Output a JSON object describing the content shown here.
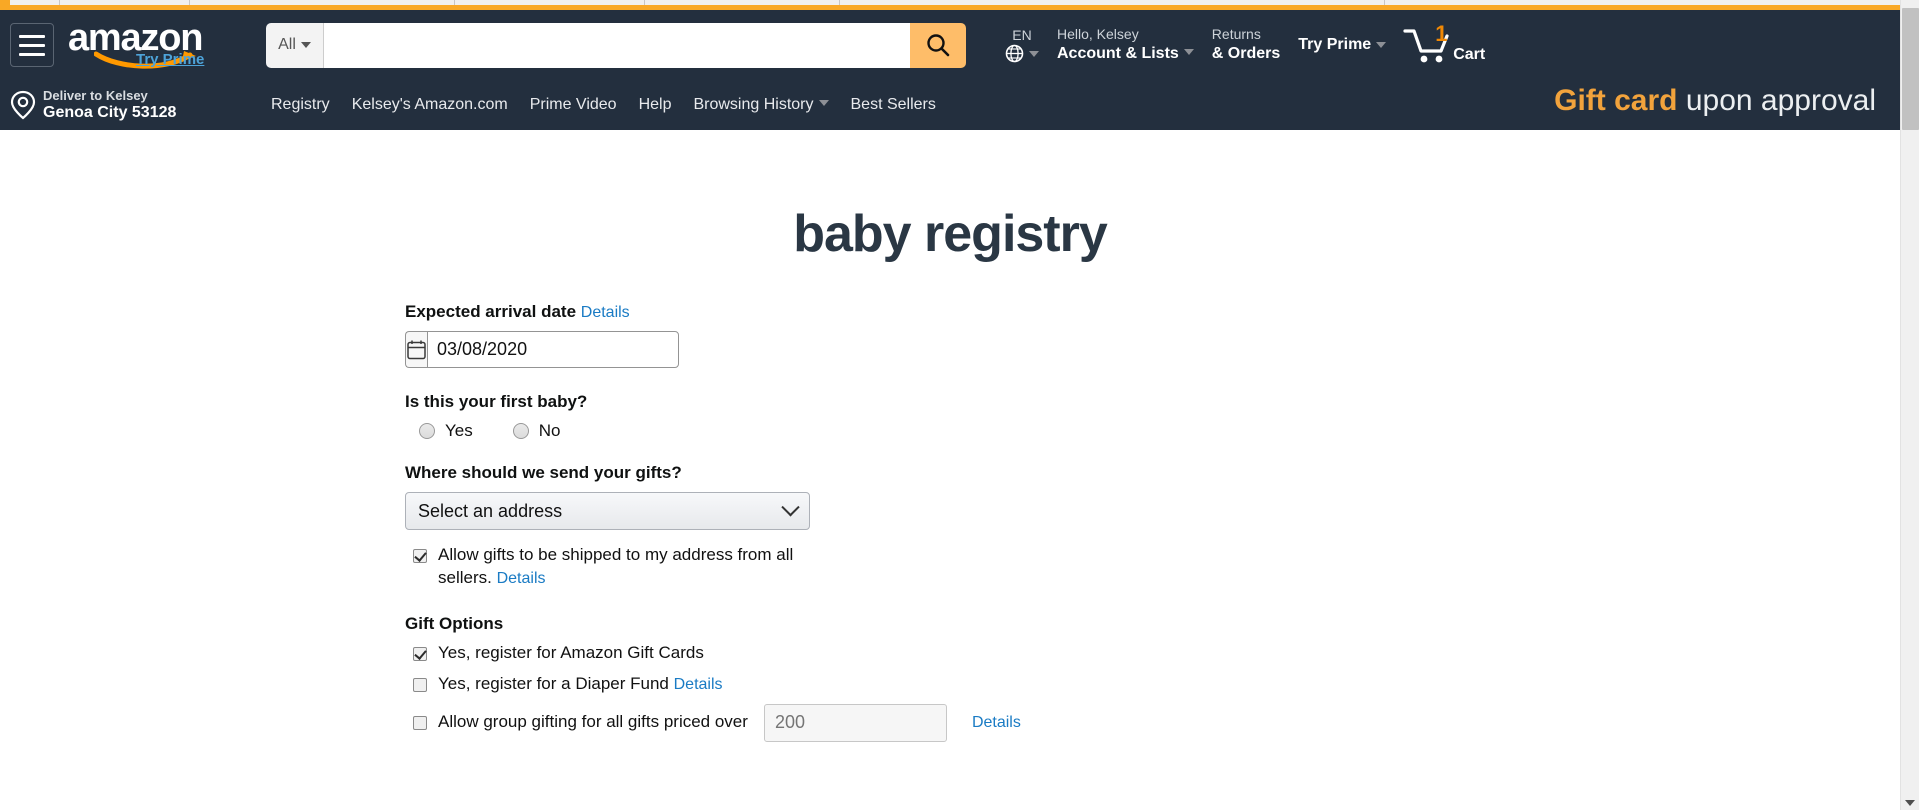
{
  "browser": {
    "tab_strip_color": "#f1f0ee",
    "accent_color": "#f9a825"
  },
  "header": {
    "bg_color": "#232f3e",
    "logo_text": "amazon",
    "logo_subtext": "Try Prime",
    "search": {
      "category": "All",
      "value": "",
      "placeholder": ""
    },
    "language": {
      "code": "EN"
    },
    "account": {
      "line1": "Hello, Kelsey",
      "line2": "Account & Lists"
    },
    "orders": {
      "line1": "Returns",
      "line2": "& Orders"
    },
    "try_prime": "Try Prime",
    "cart": {
      "count": "1",
      "label": "Cart"
    },
    "deliver": {
      "line1": "Deliver to Kelsey",
      "line2": "Genoa City 53128"
    },
    "subnav": [
      "Registry",
      "Kelsey's Amazon.com",
      "Prime Video",
      "Help",
      "Browsing History",
      "Best Sellers"
    ],
    "promo": {
      "highlight": "Gift card",
      "rest": " upon approval",
      "highlight_color": "#f2a33c"
    }
  },
  "page": {
    "title": "baby registry",
    "form": {
      "arrival": {
        "label": "Expected arrival date",
        "details": "Details",
        "value": "03/08/2020"
      },
      "first_baby": {
        "label": "Is this your first baby?",
        "options": [
          "Yes",
          "No"
        ],
        "selected": ""
      },
      "address": {
        "label": "Where should we send your gifts?",
        "selected": "Select an address",
        "allow_ship_text": "Allow gifts to be shipped to my address from all sellers.",
        "allow_ship_details": "Details",
        "allow_ship_checked": true
      },
      "gift_options": {
        "title": "Gift Options",
        "gift_cards": {
          "label": "Yes, register for Amazon Gift Cards",
          "checked": true
        },
        "diaper_fund": {
          "label": "Yes, register for a Diaper Fund",
          "details": "Details",
          "checked": false
        },
        "group_gifting": {
          "label": "Allow group gifting for all gifts priced over",
          "amount_placeholder": "200",
          "amount_value": "",
          "details": "Details",
          "checked": false
        }
      }
    }
  }
}
